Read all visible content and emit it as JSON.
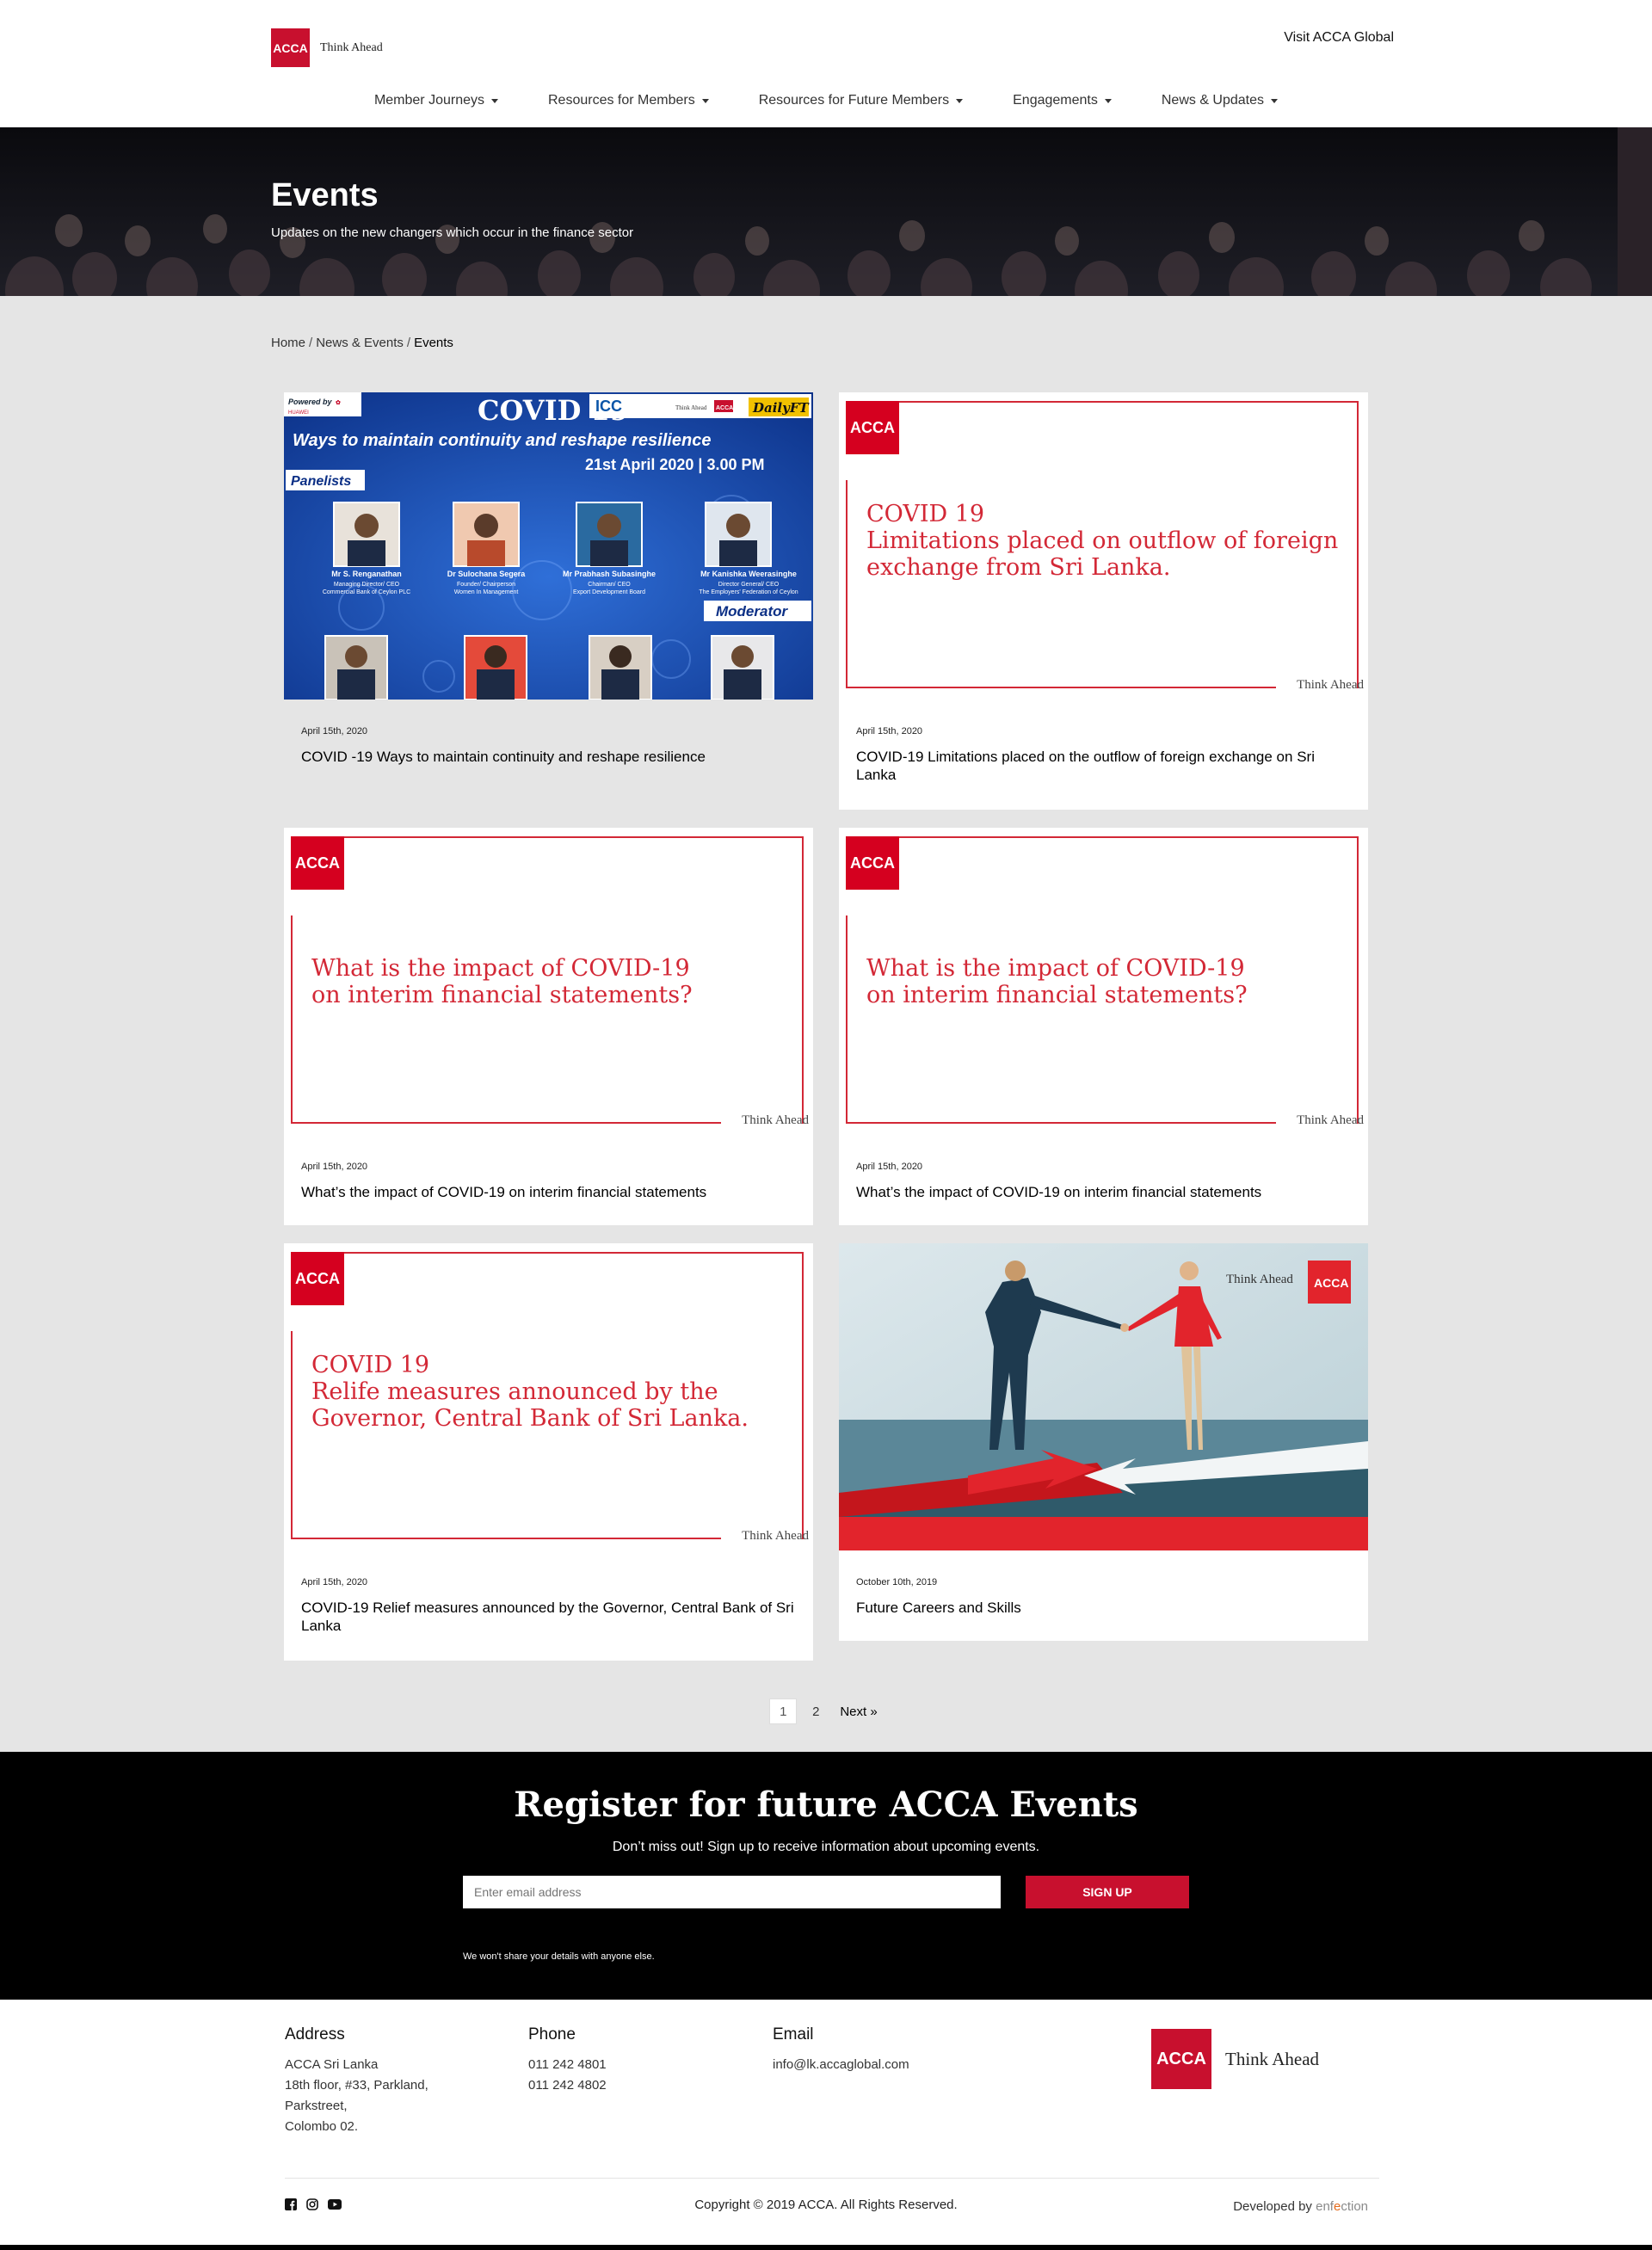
{
  "header": {
    "logo_mark": "ACCA",
    "logo_text": "Think Ahead",
    "visit_global": "Visit ACCA Global",
    "nav": [
      {
        "label": "Member Journeys"
      },
      {
        "label": "Resources for Members"
      },
      {
        "label": "Resources for Future Members"
      },
      {
        "label": "Engagements"
      },
      {
        "label": "News & Updates"
      }
    ]
  },
  "hero": {
    "title": "Events",
    "subtitle": "Updates on the new changers which occur in the finance sector"
  },
  "breadcrumb": {
    "home": "Home",
    "section": "News & Events",
    "current": "Events"
  },
  "cards": [
    {
      "date": "April 15th, 2020",
      "title": "COVID -19 Ways to maintain continuity and reshape resilience",
      "poster": {
        "powered_by": "Powered by",
        "sponsor": "HUAWEI",
        "heading": "COVID 19",
        "subheading": "Ways to maintain continuity and reshape resilience",
        "datetime": "21st April 2020 | 3.00 PM",
        "panelists_label": "Panelists",
        "moderator_label": "Moderator",
        "icc": "ICC",
        "think_ahead": "Think Ahead",
        "acca": "ACCA",
        "dailyft": "DailyFT",
        "panelists": [
          {
            "name": "Mr S. Renganathan",
            "role1": "Managing Director/ CEO",
            "role2": "Commercial Bank of Ceylon PLC"
          },
          {
            "name": "Dr Sulochana Segera",
            "role1": "Founder/ Chairperson",
            "role2": "Women In Management"
          },
          {
            "name": "Mr Prabhash Subasinghe",
            "role1": "Chairman/ CEO",
            "role2": "Export Development Board"
          },
          {
            "name": "Mr Kanishka Weerasinghe",
            "role1": "Director General/ CEO",
            "role2": "The Employers' Federation of Ceylon"
          }
        ]
      }
    },
    {
      "date": "April 15th, 2020",
      "title": "COVID-19 Limitations placed on the outflow of foreign exchange on Sri Lanka",
      "graphic": {
        "line1": "COVID 19",
        "line2": "Limitations placed on outflow of foreign",
        "line3": "exchange from Sri Lanka.",
        "logo": "ACCA",
        "tagline": "Think Ahead"
      }
    },
    {
      "date": "April 15th, 2020",
      "title": "What’s the impact of COVID-19 on interim financial statements",
      "graphic": {
        "line1": "What is the impact of COVID-19",
        "line2": "on interim financial statements?",
        "logo": "ACCA",
        "tagline": "Think Ahead"
      }
    },
    {
      "date": "April 15th, 2020",
      "title": "What’s the impact of COVID-19 on interim financial statements",
      "graphic": {
        "line1": "What is the impact of COVID-19",
        "line2": "on interim financial statements?",
        "logo": "ACCA",
        "tagline": "Think Ahead"
      }
    },
    {
      "date": "April 15th, 2020",
      "title": "COVID-19 Relief measures announced by the Governor, Central Bank of Sri Lanka",
      "graphic": {
        "line1": "COVID 19",
        "line2": "Relife measures announced by the",
        "line3": "Governor, Central Bank of Sri Lanka.",
        "logo": "ACCA",
        "tagline": "Think Ahead"
      }
    },
    {
      "date": "October 10th, 2019",
      "title": "Future Careers and Skills",
      "illustration": {
        "tagline": "Think Ahead",
        "logo": "ACCA"
      }
    }
  ],
  "pagination": {
    "pages": [
      "1",
      "2"
    ],
    "current": "1",
    "next": "Next »"
  },
  "register": {
    "title": "Register for future ACCA Events",
    "subtitle": "Don’t miss out! Sign up to receive information about upcoming events.",
    "email_placeholder": "Enter email address",
    "button": "SIGN UP",
    "note": "We won't share your details with anyone else."
  },
  "footer": {
    "address": {
      "heading": "Address",
      "lines": [
        "ACCA Sri Lanka",
        "18th floor, #33, Parkland,",
        "Parkstreet,",
        "Colombo 02."
      ]
    },
    "phone": {
      "heading": "Phone",
      "lines": [
        "011 242 4801",
        "011 242 4802"
      ]
    },
    "email": {
      "heading": "Email",
      "lines": [
        "info@lk.accaglobal.com"
      ]
    },
    "logo_mark": "ACCA",
    "logo_text": "Think Ahead",
    "copyright": "Copyright © 2019 ACCA. All Rights Reserved.",
    "developed_by": "Developed by",
    "developer_pre": "enf",
    "developer_e": "e",
    "developer_post": "ction",
    "social": [
      "facebook-icon",
      "instagram-icon",
      "youtube-icon"
    ]
  },
  "colors": {
    "accent": "#c8102e",
    "graphic_red": "#d32836",
    "page_bg": "#e5e5e5",
    "band_bg": "#000000"
  }
}
